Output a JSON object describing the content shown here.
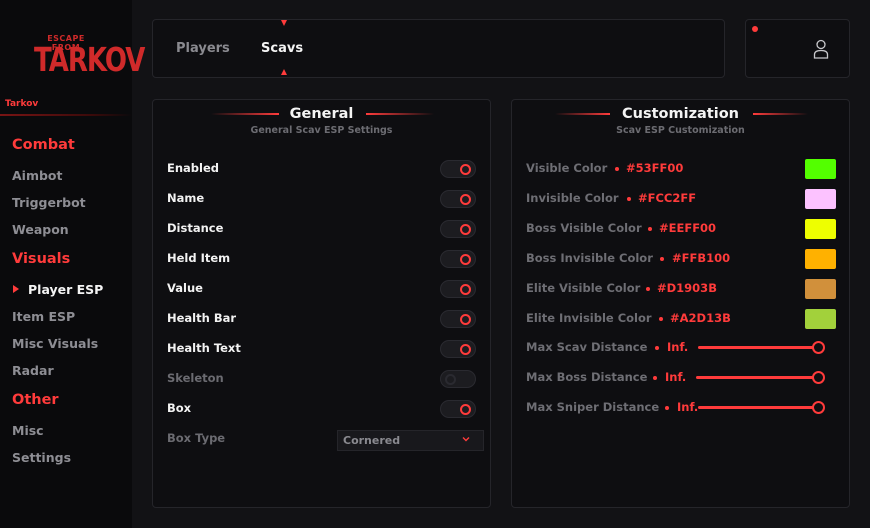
{
  "sidebar": {
    "logo": {
      "top": "ESCAPE FROM",
      "main": "TARKOV"
    },
    "brand": "Tarkov",
    "sections": [
      {
        "title": "Combat",
        "items": [
          "Aimbot",
          "Triggerbot",
          "Weapon"
        ]
      },
      {
        "title": "Visuals",
        "items": [
          "Player ESP",
          "Item ESP",
          "Misc Visuals",
          "Radar"
        ]
      },
      {
        "title": "Other",
        "items": [
          "Misc",
          "Settings"
        ]
      }
    ],
    "active_item": "Player ESP"
  },
  "tabs": [
    {
      "label": "Players",
      "active": false
    },
    {
      "label": "Scavs",
      "active": true
    }
  ],
  "general": {
    "title": "General",
    "subtitle": "General Scav ESP Settings",
    "rows": [
      {
        "label": "Enabled",
        "on": true,
        "disabled": false
      },
      {
        "label": "Name",
        "on": true,
        "disabled": false
      },
      {
        "label": "Distance",
        "on": true,
        "disabled": false
      },
      {
        "label": "Held Item",
        "on": true,
        "disabled": false
      },
      {
        "label": "Value",
        "on": true,
        "disabled": false
      },
      {
        "label": "Health Bar",
        "on": true,
        "disabled": false
      },
      {
        "label": "Health Text",
        "on": true,
        "disabled": false
      },
      {
        "label": "Skeleton",
        "on": false,
        "disabled": true
      },
      {
        "label": "Box",
        "on": true,
        "disabled": false
      }
    ],
    "box_type": {
      "label": "Box Type",
      "value": "Cornered"
    }
  },
  "customization": {
    "title": "Customization",
    "subtitle": "Scav ESP Customization",
    "colors": [
      {
        "label": "Visible Color",
        "value": "#53FF00",
        "color": "#53FF00"
      },
      {
        "label": "Invisible Color",
        "value": "#FCC2FF",
        "color": "#FCC2FF"
      },
      {
        "label": "Boss Visible Color",
        "value": "#EEFF00",
        "color": "#EEFF00"
      },
      {
        "label": "Boss Invisible Color",
        "value": "#FFB100",
        "color": "#FFB100"
      },
      {
        "label": "Elite Visible Color",
        "value": "#D1903B",
        "color": "#D1903B"
      },
      {
        "label": "Elite Invisible Color",
        "value": "#A2D13B",
        "color": "#A2D13B"
      }
    ],
    "sliders": [
      {
        "label": "Max Scav Distance",
        "value": "Inf.",
        "fraction": 1.0
      },
      {
        "label": "Max Boss Distance",
        "value": "Inf.",
        "fraction": 1.0
      },
      {
        "label": "Max Sniper Distance",
        "value": "Inf.",
        "fraction": 1.0
      }
    ]
  },
  "colors": {
    "accent": "#FF3B3B"
  }
}
